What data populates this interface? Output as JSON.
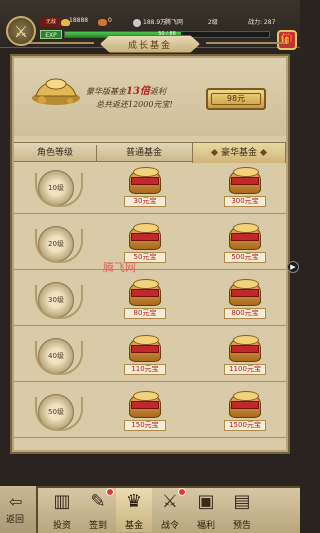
{
  "topbar": {
    "vip": "无敌",
    "gold": "18888",
    "ingot": "0",
    "currency": "188.9万",
    "player_name": "腾飞网",
    "level": "2级",
    "power": "战力: 287",
    "exp_label": "EXP",
    "exp_text": "50 / 88",
    "exp_progress": 0.57
  },
  "title": "成长基金",
  "promo": {
    "line1_prefix": "豪华版基金",
    "line1_highlight": "13倍",
    "line1_suffix": "返利",
    "line2": "总共返还12000元宝!",
    "buy_price": "98元"
  },
  "table": {
    "headers": [
      "角色等级",
      "普通基金",
      "豪华基金"
    ],
    "rows": [
      {
        "level": "10级",
        "normal": "30元宝",
        "luxury": "300元宝"
      },
      {
        "level": "20级",
        "normal": "50元宝",
        "luxury": "500元宝"
      },
      {
        "level": "30级",
        "normal": "80元宝",
        "luxury": "800元宝"
      },
      {
        "level": "40级",
        "normal": "110元宝",
        "luxury": "1100元宝"
      },
      {
        "level": "50级",
        "normal": "150元宝",
        "luxury": "1500元宝"
      }
    ]
  },
  "watermark": "腾飞网",
  "bottom_nav": {
    "back": "返回",
    "items": [
      {
        "label": "投资",
        "icon": "coin-stack-icon",
        "badge": false
      },
      {
        "label": "签到",
        "icon": "sign-in-icon",
        "badge": true
      },
      {
        "label": "基金",
        "icon": "fund-icon",
        "badge": false,
        "active": true
      },
      {
        "label": "战令",
        "icon": "battle-order-icon",
        "badge": true
      },
      {
        "label": "福利",
        "icon": "gift-box-icon",
        "badge": false
      },
      {
        "label": "预告",
        "icon": "book-icon",
        "badge": false
      }
    ]
  },
  "colors": {
    "accent_red": "#b12020",
    "panel_bg": "#d9cba7",
    "frame": "#7a6440"
  }
}
